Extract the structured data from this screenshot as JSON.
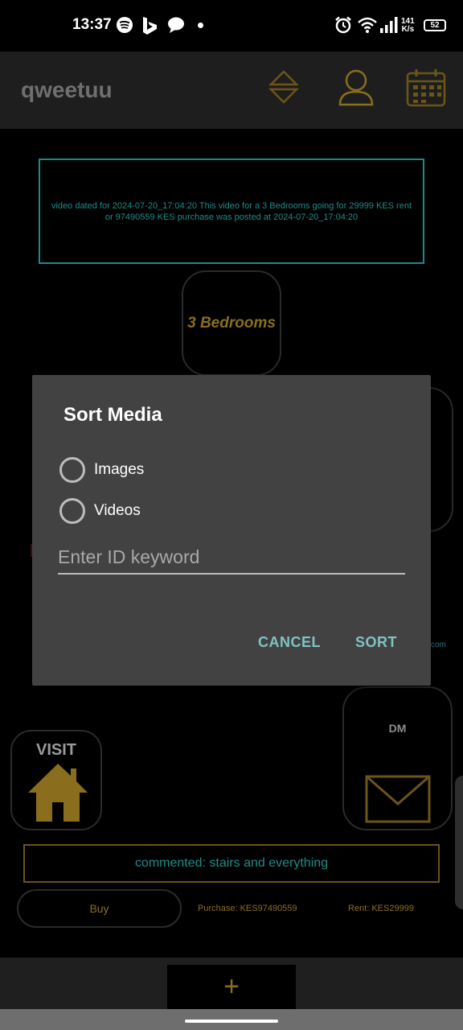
{
  "status_bar": {
    "time": "13:37",
    "speed_value": "141",
    "speed_unit": "K/s",
    "battery": "52",
    "icons": [
      "spotify-icon",
      "bing-icon",
      "chat-bubble-icon",
      "notification-dot-icon",
      "alarm-icon",
      "wifi-icon",
      "signal-icon"
    ]
  },
  "app_bar": {
    "title": "qweetuu",
    "icons": [
      "sort-arrows-icon",
      "profile-icon",
      "calendar-icon"
    ]
  },
  "post": {
    "info": "video dated for 2024-07-20_17:04:20 This video for a 3 Bedrooms going for 29999 KES rent or 97490559 KES purchase was posted at 2024-07-20_17:04:20",
    "bedrooms": "3 Bedrooms",
    "com_fragment": "com",
    "dm_label": "DM",
    "visit_label": "VISIT",
    "comment": "commented: stairs and everything",
    "buy_label": "Buy",
    "purchase": "Purchase: KES97490559",
    "rent": "Rent: KES29999"
  },
  "bottom_bar": {
    "add_label": "+"
  },
  "dialog": {
    "title": "Sort Media",
    "options": [
      {
        "label": "Images",
        "selected": false
      },
      {
        "label": "Videos",
        "selected": false
      }
    ],
    "input_placeholder": "Enter ID keyword",
    "input_value": "",
    "cancel_label": "CANCEL",
    "sort_label": "SORT"
  },
  "colors": {
    "accent_gold": "#8a6e1d",
    "accent_teal": "#1e8c86",
    "dialog_button": "#7fc3c3",
    "dialog_bg": "#424242"
  }
}
